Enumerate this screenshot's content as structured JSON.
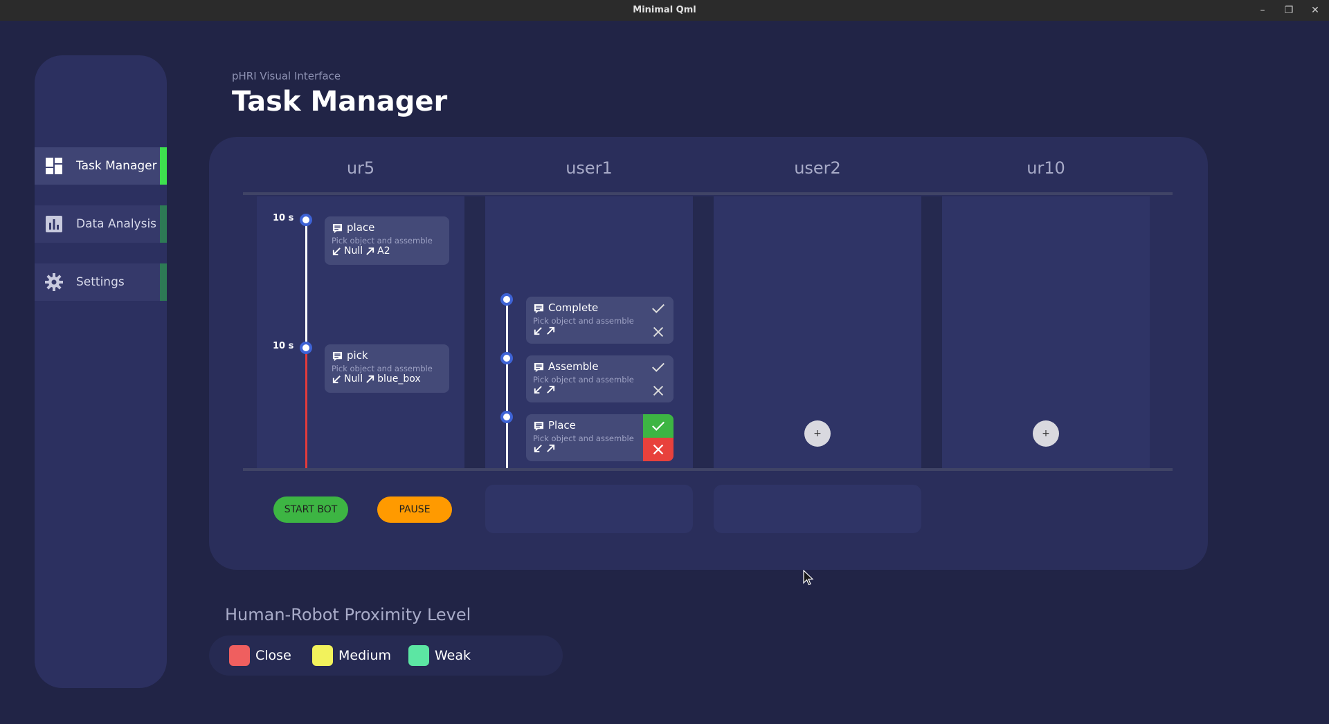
{
  "window": {
    "title": "Minimal Qml",
    "minimize": "–",
    "restore": "❐",
    "close": "✕"
  },
  "sidebar": {
    "items": [
      {
        "label": "Task Manager",
        "icon": "dashboard-icon",
        "active": true
      },
      {
        "label": "Data Analysis",
        "icon": "bar-chart-icon",
        "active": false
      },
      {
        "label": "Settings",
        "icon": "gear-icon",
        "active": false
      }
    ]
  },
  "header": {
    "subtitle": "pHRI Visual Interface",
    "title": "Task Manager"
  },
  "columns": [
    "ur5",
    "user1",
    "user2",
    "ur10"
  ],
  "ur5_tasks": [
    {
      "time": "10 s",
      "title": "place",
      "description": "Pick object and assemble",
      "input": "Null",
      "output": "A2"
    },
    {
      "time": "10 s",
      "title": "pick",
      "description": "Pick object and assemble",
      "input": "Null",
      "output": "blue_box"
    }
  ],
  "user1_tasks": [
    {
      "title": "Complete",
      "description": "Pick object and assemble",
      "state": "pending"
    },
    {
      "title": "Assemble",
      "description": "Pick object and assemble",
      "state": "pending"
    },
    {
      "title": "Place",
      "description": "Pick object and assemble",
      "state": "active"
    }
  ],
  "add_label": "+",
  "controls": {
    "start": "START BOT",
    "pause": "PAUSE"
  },
  "colors": {
    "start": "#3db543",
    "pause": "#ff9a00",
    "accent": "#3ee04f",
    "approve": "#3db543",
    "reject": "#e8413c",
    "node": "#3e63d6",
    "timeline_active": "#e23b3b"
  },
  "legend": {
    "title": "Human-Robot Proximity Level",
    "items": [
      {
        "label": "Close",
        "color": "#ef5f5f"
      },
      {
        "label": "Medium",
        "color": "#f2f25c"
      },
      {
        "label": "Weak",
        "color": "#5ce6a3"
      }
    ]
  }
}
